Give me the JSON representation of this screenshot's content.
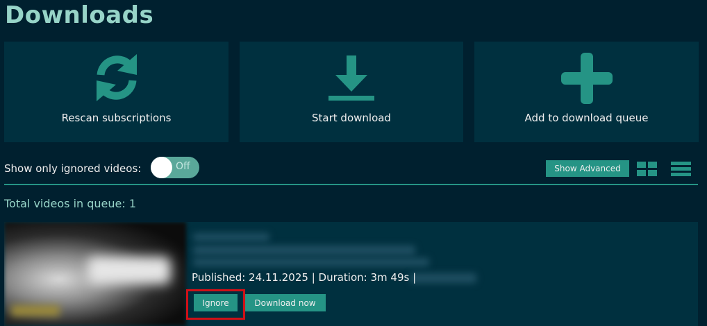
{
  "page": {
    "title": "Downloads"
  },
  "actions": [
    {
      "label": "Rescan subscriptions",
      "icon": "rescan-icon"
    },
    {
      "label": "Start download",
      "icon": "download-icon"
    },
    {
      "label": "Add to download queue",
      "icon": "plus-icon"
    }
  ],
  "filters": {
    "ignored_label": "Show only ignored videos:",
    "ignored_state": "Off",
    "show_advanced": "Show Advanced",
    "view_icons": [
      "grid-view-icon",
      "list-view-icon"
    ]
  },
  "queue": {
    "total_label": "Total videos in queue: 1",
    "items": [
      {
        "published": "Published: 24.11.2025 | Duration: 3m 49s |",
        "ignore_label": "Ignore",
        "download_label": "Download now"
      }
    ]
  },
  "colors": {
    "background": "#00202f",
    "panel": "#00303f",
    "accent": "#259485",
    "title": "#97d4c8",
    "highlight": "#d01017"
  }
}
